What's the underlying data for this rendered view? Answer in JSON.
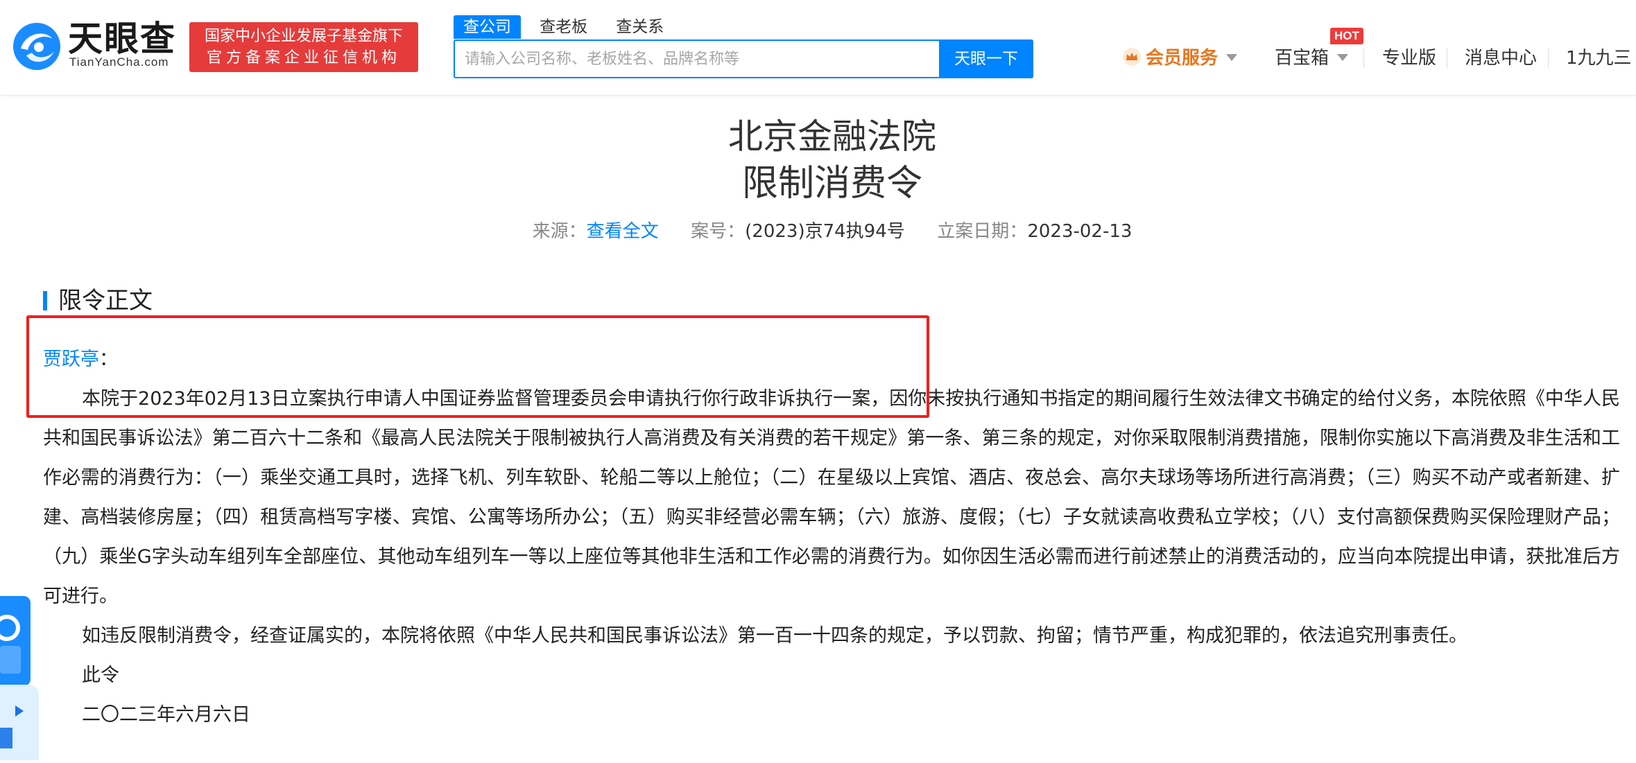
{
  "header": {
    "logo_title": "天眼查",
    "logo_sub": "TianYanCha.com",
    "banner_line1": "国家中小企业发展子基金旗下",
    "banner_line2": "官方备案企业征信机构",
    "search_tabs": [
      "查公司",
      "查老板",
      "查关系"
    ],
    "search_placeholder": "请输入公司名称、老板姓名、品牌名称等",
    "search_button": "天眼一下",
    "nav": {
      "vip": "会员服务",
      "baobao": "百宝箱",
      "hot": "HOT",
      "pro": "专业版",
      "messages": "消息中心",
      "user": "1九九三"
    }
  },
  "document": {
    "court": "北京金融法院",
    "title": "限制消费令",
    "source_label": "来源：",
    "source_link": "查看全文",
    "case_label": "案号：",
    "case_no": "(2023)京74执94号",
    "date_label": "立案日期：",
    "date": "2023-02-13",
    "section_title": "限令正文",
    "addressee": "贾跃亭",
    "addressee_colon": "：",
    "para1": "本院于2023年02月13日立案执行申请人中国证券监督管理委员会申请执行你行政非诉执行一案，因你未按执行通知书指定的期间履行生效法律文书确定的给付义务，本院依照《中华人民共和国民事诉讼法》第二百六十二条和《最高人民法院关于限制被执行人高消费及有关消费的若干规定》第一条、第三条的规定，对你采取限制消费措施，限制你实施以下高消费及非生活和工作必需的消费行为：（一）乘坐交通工具时，选择飞机、列车软卧、轮船二等以上舱位；（二）在星级以上宾馆、酒店、夜总会、高尔夫球场等场所进行高消费；（三）购买不动产或者新建、扩建、高档装修房屋；（四）租赁高档写字楼、宾馆、公寓等场所办公；（五）购买非经营必需车辆；（六）旅游、度假；（七）子女就读高收费私立学校；（八）支付高额保费购买保险理财产品；（九）乘坐G字头动车组列车全部座位、其他动车组列车一等以上座位等其他非生活和工作必需的消费行为。如你因生活必需而进行前述禁止的消费活动的，应当向本院提出申请，获批准后方可进行。",
    "para2": "如违反限制消费令，经查证属实的，本院将依照《中华人民共和国民事诉讼法》第一百一十四条的规定，予以罚款、拘留；情节严重，构成犯罪的，依法追究刑事责任。",
    "closing": "此令",
    "sign_date": "二〇二三年六月六日"
  },
  "colors": {
    "accent": "#0084ff",
    "banner_red": "#e63b3b",
    "highlight_red": "#ee2020",
    "vip_orange": "#e8761e"
  }
}
